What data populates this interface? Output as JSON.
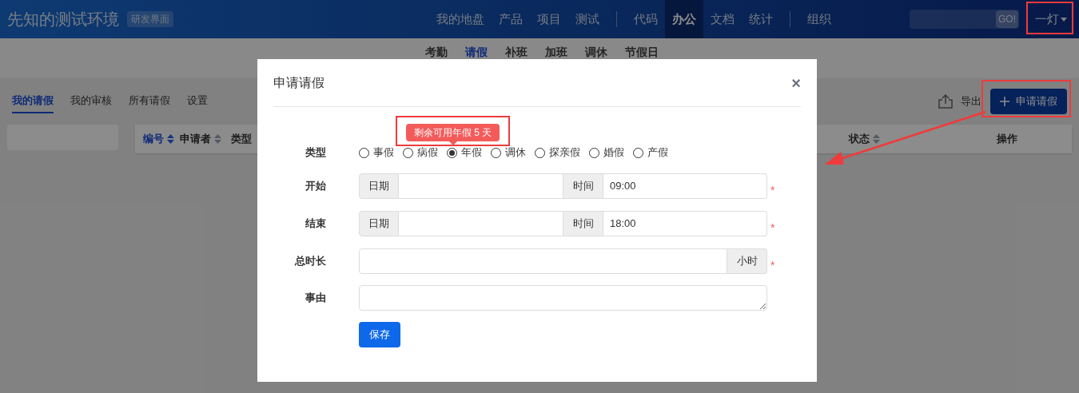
{
  "header": {
    "logo": "先知的测试环境",
    "badge": "研发界面",
    "nav_groups": [
      [
        {
          "label": "我的地盘",
          "selected": false
        },
        {
          "label": "产品",
          "selected": false
        },
        {
          "label": "项目",
          "selected": false
        },
        {
          "label": "测试",
          "selected": false
        }
      ],
      [
        {
          "label": "代码",
          "selected": false
        },
        {
          "label": "办公",
          "selected": true
        },
        {
          "label": "文档",
          "selected": false
        },
        {
          "label": "统计",
          "selected": false
        }
      ],
      [
        {
          "label": "组织",
          "selected": false
        }
      ]
    ],
    "search": {
      "button": "GO!"
    },
    "user": "一灯"
  },
  "subnav": [
    {
      "label": "考勤",
      "selected": false
    },
    {
      "label": "请假",
      "selected": true
    },
    {
      "label": "补班",
      "selected": false
    },
    {
      "label": "加班",
      "selected": false
    },
    {
      "label": "调休",
      "selected": false
    },
    {
      "label": "节假日",
      "selected": false
    }
  ],
  "tabs": [
    {
      "label": "我的请假",
      "selected": true
    },
    {
      "label": "我的审核",
      "selected": false
    },
    {
      "label": "所有请假",
      "selected": false
    },
    {
      "label": "设置",
      "selected": false
    }
  ],
  "toolbar": {
    "export": "导出",
    "apply": "申请请假"
  },
  "table": {
    "columns": [
      {
        "label": "编号",
        "sortable": true,
        "sorted": true
      },
      {
        "label": "申请者",
        "sortable": true,
        "sorted": false
      },
      {
        "label": "类型",
        "sortable": false,
        "sorted": false
      },
      {
        "label": "状态",
        "sortable": true,
        "sorted": false
      },
      {
        "label": "操作",
        "sortable": false,
        "sorted": false
      }
    ]
  },
  "modal": {
    "title": "申请请假",
    "close": "×",
    "type_label": "类型",
    "tooltip": "剩余可用年假 5 天",
    "types": [
      {
        "label": "事假",
        "selected": false
      },
      {
        "label": "病假",
        "selected": false
      },
      {
        "label": "年假",
        "selected": true
      },
      {
        "label": "调休",
        "selected": false
      },
      {
        "label": "探亲假",
        "selected": false
      },
      {
        "label": "婚假",
        "selected": false
      },
      {
        "label": "产假",
        "selected": false
      }
    ],
    "rows": [
      {
        "kind": "datetime",
        "label": "开始",
        "date_addon": "日期",
        "time_addon": "时间",
        "time": "09:00",
        "required": true
      },
      {
        "kind": "datetime",
        "label": "结束",
        "date_addon": "日期",
        "time_addon": "时间",
        "time": "18:00",
        "required": true
      },
      {
        "kind": "unit",
        "label": "总时长",
        "unit": "小时",
        "required": true
      },
      {
        "kind": "textarea",
        "label": "事由",
        "required": false
      }
    ],
    "save": "保存",
    "required_mark": "*"
  }
}
